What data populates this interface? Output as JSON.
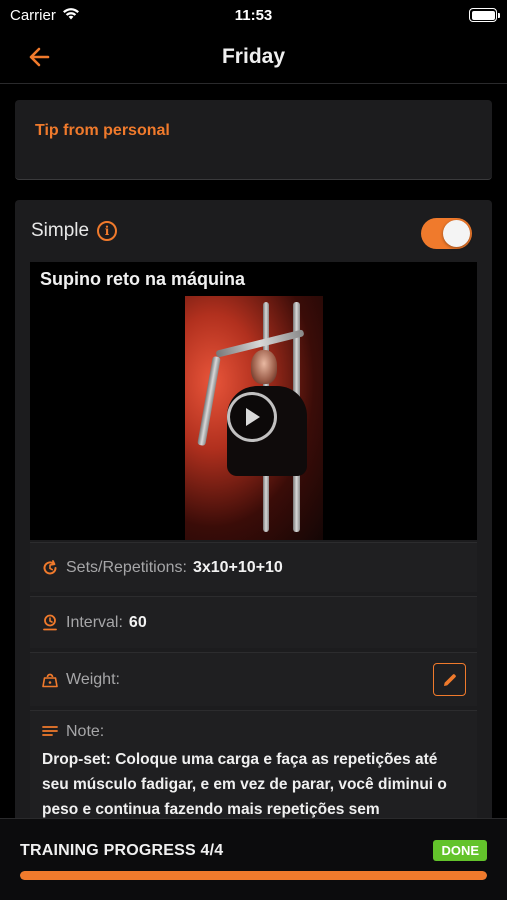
{
  "status": {
    "carrier": "Carrier",
    "time": "11:53",
    "battery_level": 1.0
  },
  "nav": {
    "title": "Friday",
    "back_icon": "arrow-left-icon"
  },
  "tip": {
    "title": "Tip from personal"
  },
  "exercise": {
    "mode_label": "Simple",
    "mode_toggle_on": true,
    "name": "Supino reto na máquina",
    "sets_label": "Sets/Repetitions:",
    "sets_value": "3x10+10+10",
    "interval_label": "Interval:",
    "interval_value": "60",
    "weight_label": "Weight:",
    "weight_value": "",
    "note_label": "Note:",
    "note_text": "Drop-set: Coloque uma carga e faça as repetições até seu músculo fadigar, e em vez de parar, você diminui o peso e continua fazendo mais repetições sem"
  },
  "progress": {
    "label": "TRAINING PROGRESS 4/4",
    "badge": "DONE",
    "fraction": 1.0
  },
  "colors": {
    "accent": "#f07a2c",
    "done": "#63c32b",
    "background": "#000000",
    "card": "#1c1c1e"
  }
}
